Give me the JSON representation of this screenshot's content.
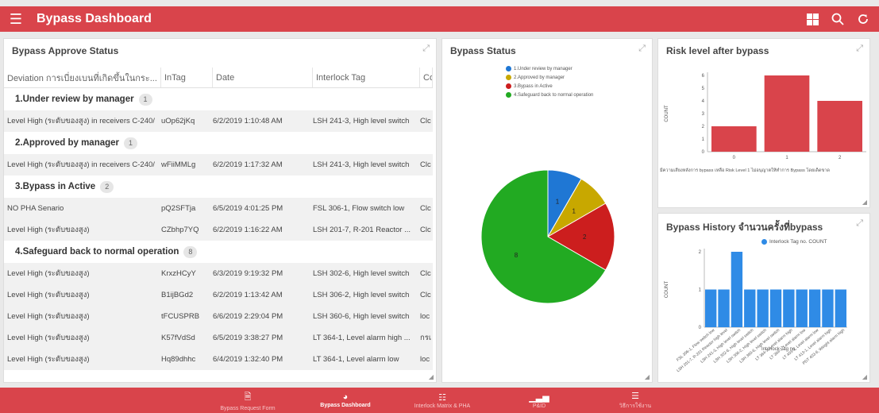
{
  "app": {
    "title": "Bypass Dashboard",
    "accent": "#d9444b"
  },
  "approve_panel": {
    "title": "Bypass Approve Status",
    "columns": [
      "Deviation การเบี่ยงเบนที่เกิดขึ้นในกระ...",
      "InTag",
      "Date",
      "Interlock Tag",
      "Co"
    ],
    "groups": [
      {
        "label": "1.Under review by manager",
        "count": "1",
        "rows": [
          [
            "Level High (ระดับของสูง) in receivers C-240/",
            "uOp62jKq",
            "6/2/2019 1:10:48 AM",
            "LSH 241-3, High level switch",
            "Clc"
          ]
        ]
      },
      {
        "label": "2.Approved by manager",
        "count": "1",
        "rows": [
          [
            "Level High (ระดับของสูง) in receivers C-240/",
            "wFiiMMLg",
            "6/2/2019 1:17:32 AM",
            "LSH 241-3, High level switch",
            "Clc"
          ]
        ]
      },
      {
        "label": "3.Bypass in Active",
        "count": "2",
        "rows": [
          [
            "NO PHA Senario",
            "pQ2SFTja",
            "6/5/2019 4:01:25 PM",
            "FSL 306-1, Flow switch low",
            "Clc"
          ],
          [
            "Level High (ระดับของสูง)",
            "CZbhp7YQ",
            "6/2/2019 1:16:22 AM",
            "LSH 201-7, R-201 Reactor ...",
            "Clc"
          ]
        ]
      },
      {
        "label": "4.Safeguard back to normal operation",
        "count": "8",
        "rows": [
          [
            "Level High (ระดับของสูง)",
            "KrxzHCyY",
            "6/3/2019 9:19:32 PM",
            "LSH 302-6, High level switch",
            "Clc"
          ],
          [
            "Level High (ระดับของสูง)",
            "B1ijBGd2",
            "6/2/2019 1:13:42 AM",
            "LSH 306-2, High level switch",
            "Clc"
          ],
          [
            "Level High (ระดับของสูง)",
            "tFCUSPRB",
            "6/6/2019 2:29:04 PM",
            "LSH 360-6, High level switch",
            "loc"
          ],
          [
            "Level High (ระดับของสูง)",
            "K57fVdSd",
            "6/5/2019 3:38:27 PM",
            "LT 364-1, Level alarm high ...",
            "กรเ"
          ],
          [
            "Level High (ระดับของสูง)",
            "Hq89dhhc",
            "6/4/2019 1:32:40 PM",
            "LT 364-1, Level alarm low",
            "loc"
          ]
        ]
      }
    ]
  },
  "status_panel": {
    "title": "Bypass Status",
    "legend": [
      {
        "label": "1.Under review by manager",
        "color": "#1f77d4"
      },
      {
        "label": "2.Approved by manager",
        "color": "#c8a800"
      },
      {
        "label": "3.Bypass in Active",
        "color": "#cc1e1e"
      },
      {
        "label": "4.Safeguard back to normal operation",
        "color": "#22aa22"
      }
    ]
  },
  "risk_panel": {
    "title": "Risk level after bypass",
    "footnote": "มีความเสี่ยงหลังการ bypass เหลือ Risk Level 1 ไม่อนุญาตให้ทำการ Bypass โดยเด็ดขาด"
  },
  "history_panel": {
    "title": "Bypass History จำนวนครั้งที่bypass",
    "legend_label": "Interlock Tag no. COUNT",
    "x_label": "Interlock Tag no."
  },
  "chart_data": [
    {
      "type": "pie",
      "title": "Bypass Status",
      "categories": [
        "1.Under review by manager",
        "2.Approved by manager",
        "3.Bypass in Active",
        "4.Safeguard back to normal operation"
      ],
      "values": [
        1,
        1,
        2,
        8
      ],
      "colors": [
        "#1f77d4",
        "#c8a800",
        "#cc1e1e",
        "#22aa22"
      ],
      "legend": "top"
    },
    {
      "type": "bar",
      "title": "Risk level after bypass",
      "categories": [
        "0",
        "1",
        "2"
      ],
      "values": [
        2,
        6,
        4
      ],
      "ylabel": "COUNT",
      "ylim": [
        0,
        6
      ],
      "yticks": [
        0,
        1,
        2,
        3,
        4,
        5,
        6
      ],
      "color": "#d9444b"
    },
    {
      "type": "bar",
      "title": "Bypass History จำนวนครั้งที่bypass",
      "categories": [
        "FSL 306-1, Flow switch low",
        "LSH 201-7, R-201 Reactor high level",
        "LSH 241-3, High level switch",
        "LSH 302-6, High level switch",
        "LSH 306-2, High level switch",
        "LSH 360-6, High level switch",
        "LT 364-1, Level alarm high",
        "LT 364-1, Level alarm low",
        "LT 403-1, Level alarm low",
        "LT 413-1, Level alarm high",
        "PDT 403-6, Weight alarm high"
      ],
      "series": [
        {
          "name": "Interlock Tag no. COUNT",
          "values": [
            1,
            1,
            2,
            1,
            1,
            1,
            1,
            1,
            1,
            1,
            1
          ]
        }
      ],
      "ylabel": "COUNT",
      "xlabel": "Interlock Tag no.",
      "ylim": [
        0,
        2
      ],
      "yticks": [
        0,
        1,
        2
      ],
      "color": "#2f8be6",
      "legend": "top"
    }
  ],
  "bottom_nav": [
    {
      "label": "Bypass Request Form",
      "icon": "form-icon",
      "active": false
    },
    {
      "label": "Bypass Dashboard",
      "icon": "dashboard-icon",
      "active": true
    },
    {
      "label": "Interlock Matrix & PHA",
      "icon": "matrix-icon",
      "active": false
    },
    {
      "label": "P&ID",
      "icon": "pid-icon",
      "active": false
    },
    {
      "label": "วิธีการใช้งาน",
      "icon": "list-icon",
      "active": false
    }
  ]
}
